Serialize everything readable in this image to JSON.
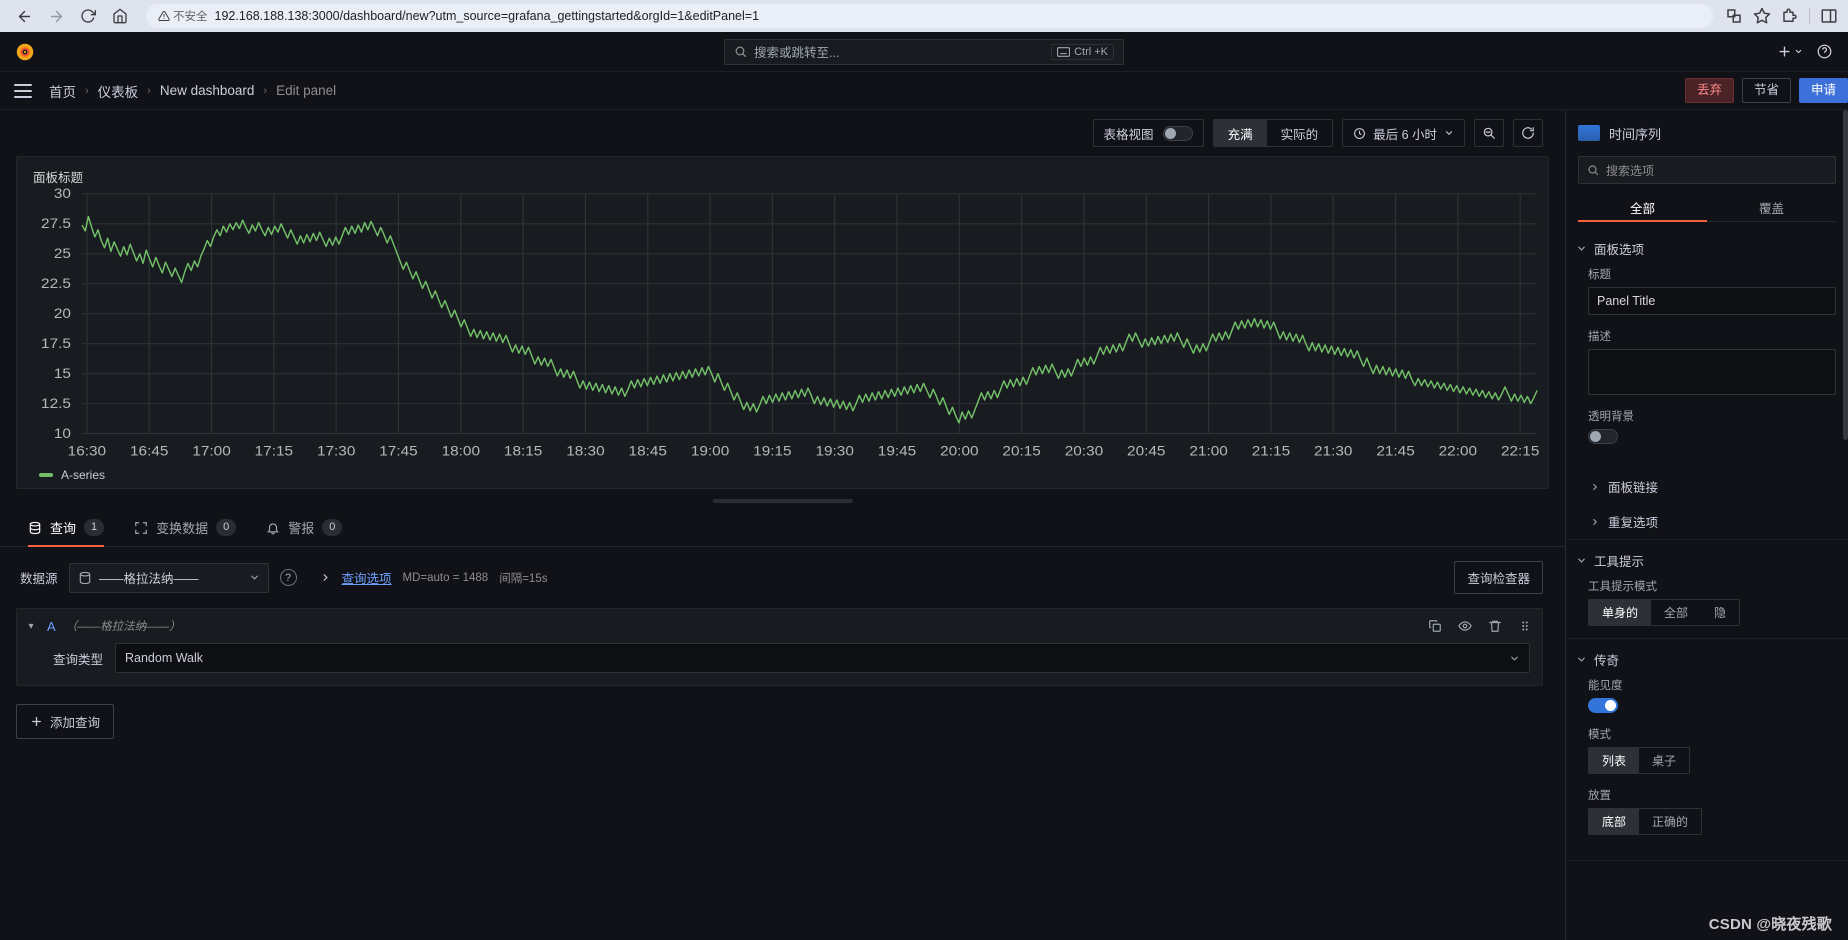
{
  "browser": {
    "back_icon": "back-arrow-icon",
    "forward_icon": "forward-arrow-icon",
    "reload_icon": "reload-icon",
    "home_icon": "home-icon",
    "security_label": "不安全",
    "url": "192.168.188.138:3000/dashboard/new?utm_source=grafana_gettingstarted&orgId=1&editPanel=1",
    "translate_icon": "translate-icon",
    "bookmark_icon": "star-icon",
    "extensions_icon": "puzzle-icon",
    "sidepanel_icon": "side-panel-icon"
  },
  "topnav": {
    "logo": "grafana-logo",
    "search_placeholder": "搜索或跳转至...",
    "search_icon": "search-icon",
    "shortcut_label": "Ctrl +K",
    "shortcut_icon": "keyboard-icon",
    "plus_label": "+",
    "help_icon": "help-circle-icon",
    "chevron_icon": "chevron-down-icon"
  },
  "breadcrumb": {
    "menu_icon": "hamburger-menu-icon",
    "items": [
      {
        "label": "首页",
        "dim": false
      },
      {
        "label": "仪表板",
        "dim": false
      },
      {
        "label": "New dashboard",
        "dim": false
      },
      {
        "label": "Edit panel",
        "dim": true
      }
    ],
    "separator": "›",
    "discard_label": "丢弃",
    "save_label": "节省",
    "apply_label": "申请"
  },
  "panel_toolbar": {
    "table_view_label": "表格视图",
    "table_view_on": false,
    "fill_label": "充满",
    "actual_label": "实际的",
    "fill_active": true,
    "time_range_label": "最后 6 小时",
    "clock_icon": "clock-icon",
    "time_chevron_icon": "chevron-down-icon",
    "zoom_out_icon": "zoom-out-icon",
    "refresh_icon": "refresh-icon"
  },
  "panel": {
    "title": "面板标题"
  },
  "chart_data": {
    "type": "line",
    "title": "面板标题",
    "xlabel": "",
    "ylabel": "",
    "ylim": [
      10,
      30
    ],
    "yticks": [
      30,
      27.5,
      25,
      22.5,
      20,
      17.5,
      15,
      12.5,
      10
    ],
    "xticks": [
      "16:30",
      "16:45",
      "17:00",
      "17:15",
      "17:30",
      "17:45",
      "18:00",
      "18:15",
      "18:30",
      "18:45",
      "19:00",
      "19:15",
      "19:30",
      "19:45",
      "20:00",
      "20:15",
      "20:30",
      "20:45",
      "21:00",
      "21:15",
      "21:30",
      "21:45",
      "22:00",
      "22:15"
    ],
    "grid": true,
    "legend_position": "bottom",
    "series": [
      {
        "name": "A-series",
        "color": "#73bf69",
        "values": [
          27.4,
          26.9,
          28.1,
          27.2,
          26.4,
          27.0,
          26.1,
          25.5,
          26.3,
          25.2,
          26.0,
          25.4,
          24.8,
          25.6,
          24.9,
          25.8,
          25.1,
          24.4,
          25.0,
          24.2,
          25.3,
          24.6,
          23.9,
          24.7,
          24.0,
          23.4,
          24.3,
          23.7,
          23.1,
          23.8,
          23.2,
          22.6,
          23.5,
          24.2,
          23.6,
          24.4,
          23.9,
          24.8,
          25.4,
          26.1,
          25.6,
          26.4,
          27.0,
          26.5,
          27.3,
          26.8,
          27.5,
          27.0,
          27.6,
          27.1,
          27.8,
          27.2,
          26.7,
          27.4,
          26.9,
          27.6,
          27.0,
          26.5,
          27.2,
          26.6,
          27.3,
          26.8,
          27.5,
          26.9,
          26.3,
          27.0,
          26.4,
          25.8,
          26.5,
          25.9,
          26.6,
          26.0,
          26.7,
          26.1,
          26.8,
          26.2,
          25.6,
          26.3,
          25.7,
          26.4,
          25.8,
          26.5,
          27.2,
          26.6,
          27.3,
          26.7,
          27.4,
          26.8,
          27.6,
          27.0,
          27.7,
          27.1,
          26.5,
          27.2,
          26.6,
          25.9,
          26.5,
          25.8,
          25.1,
          24.4,
          23.7,
          24.3,
          23.6,
          22.9,
          23.5,
          22.8,
          22.1,
          22.7,
          22.0,
          21.3,
          21.9,
          21.2,
          20.5,
          21.1,
          20.4,
          19.7,
          20.3,
          19.6,
          18.9,
          19.5,
          18.8,
          18.1,
          18.7,
          18.0,
          18.6,
          17.9,
          18.5,
          17.8,
          18.4,
          17.7,
          18.3,
          17.6,
          18.2,
          17.5,
          16.8,
          17.4,
          16.7,
          17.3,
          16.6,
          17.2,
          16.5,
          15.8,
          16.4,
          15.7,
          16.3,
          15.6,
          16.2,
          15.5,
          14.8,
          15.4,
          14.7,
          15.3,
          14.6,
          15.2,
          14.5,
          13.8,
          14.4,
          13.7,
          14.3,
          13.6,
          14.2,
          13.5,
          14.1,
          13.4,
          14.0,
          13.3,
          13.9,
          13.2,
          13.8,
          13.1,
          13.7,
          14.4,
          13.8,
          14.5,
          13.9,
          14.6,
          14.0,
          14.7,
          14.1,
          14.8,
          14.2,
          14.9,
          14.3,
          15.0,
          14.4,
          15.1,
          14.5,
          15.2,
          14.6,
          15.3,
          14.7,
          15.4,
          14.8,
          15.5,
          14.9,
          15.6,
          15.0,
          14.3,
          15.0,
          14.3,
          13.6,
          14.2,
          13.5,
          12.8,
          13.4,
          12.7,
          12.0,
          12.6,
          11.9,
          12.5,
          11.8,
          12.4,
          13.1,
          12.5,
          13.2,
          12.6,
          13.3,
          12.7,
          13.4,
          12.8,
          13.5,
          12.9,
          13.6,
          13.0,
          13.7,
          13.1,
          13.8,
          13.2,
          12.5,
          13.1,
          12.4,
          13.0,
          12.3,
          12.9,
          12.2,
          12.8,
          12.1,
          12.7,
          12.0,
          12.6,
          11.9,
          12.5,
          13.2,
          12.6,
          13.3,
          12.7,
          13.4,
          12.8,
          13.5,
          12.9,
          13.6,
          13.0,
          13.7,
          13.1,
          13.8,
          13.2,
          13.9,
          13.3,
          14.0,
          13.4,
          14.1,
          13.5,
          14.2,
          13.6,
          13.0,
          13.7,
          13.1,
          12.4,
          13.0,
          12.3,
          11.6,
          12.2,
          11.5,
          10.9,
          11.8,
          11.2,
          11.9,
          11.3,
          12.0,
          12.7,
          13.4,
          12.8,
          13.5,
          12.9,
          13.6,
          13.0,
          13.7,
          14.4,
          13.8,
          14.5,
          13.9,
          14.6,
          14.0,
          14.7,
          14.1,
          14.8,
          15.5,
          14.9,
          15.6,
          15.0,
          15.7,
          15.1,
          15.8,
          15.2,
          14.6,
          15.3,
          14.7,
          15.4,
          14.8,
          15.5,
          16.2,
          15.6,
          16.3,
          15.7,
          16.4,
          15.8,
          16.5,
          17.2,
          16.6,
          17.3,
          16.7,
          17.4,
          16.8,
          17.5,
          16.9,
          17.6,
          18.3,
          17.7,
          18.4,
          17.8,
          17.2,
          17.9,
          17.3,
          18.0,
          17.4,
          18.1,
          17.5,
          18.2,
          17.6,
          18.3,
          17.7,
          18.4,
          17.8,
          17.2,
          17.9,
          17.3,
          16.7,
          17.4,
          16.8,
          17.5,
          16.9,
          17.6,
          18.3,
          17.7,
          18.4,
          17.8,
          18.5,
          17.9,
          18.6,
          19.3,
          18.7,
          19.4,
          18.8,
          19.5,
          18.9,
          19.6,
          18.9,
          19.5,
          18.8,
          19.4,
          18.7,
          19.3,
          18.6,
          17.9,
          18.5,
          17.8,
          18.4,
          17.7,
          18.3,
          17.6,
          18.2,
          17.5,
          16.9,
          17.6,
          16.9,
          17.5,
          16.8,
          17.4,
          16.7,
          17.3,
          16.6,
          17.2,
          16.5,
          17.1,
          16.4,
          17.0,
          16.3,
          16.9,
          16.2,
          15.6,
          16.3,
          15.6,
          15.0,
          15.7,
          15.0,
          15.6,
          14.9,
          15.5,
          14.8,
          15.4,
          14.7,
          15.3,
          14.6,
          15.2,
          14.5,
          14.0,
          14.6,
          14.0,
          14.5,
          13.9,
          14.4,
          13.8,
          14.3,
          13.7,
          14.2,
          13.6,
          14.1,
          13.5,
          14.0,
          13.4,
          13.9,
          13.3,
          13.8,
          13.2,
          13.7,
          13.1,
          13.6,
          13.0,
          13.5,
          12.9,
          13.4,
          12.8,
          13.3,
          13.9,
          13.3,
          12.7,
          13.3,
          12.7,
          13.2,
          12.6,
          13.1,
          12.5,
          13.0,
          13.6
        ]
      }
    ]
  },
  "query_tabs": {
    "items": [
      {
        "label": "查询",
        "count": "1",
        "icon": "database-icon",
        "active": true
      },
      {
        "label": "变换数据",
        "count": "0",
        "icon": "transform-icon",
        "active": false
      },
      {
        "label": "警报",
        "count": "0",
        "icon": "bell-icon",
        "active": false
      }
    ]
  },
  "datasource_row": {
    "label": "数据源",
    "selected": "——格拉法纳——",
    "db_icon": "database-icon",
    "chevron_icon": "chevron-down-icon",
    "help_icon": "question-mark-icon",
    "expand_icon": "chevron-right-icon",
    "query_options_label": "查询选项",
    "md_label": "MD=auto = 1488",
    "interval_label": "间隔=15s",
    "inspector_label": "查询检查器"
  },
  "query_editor": {
    "ref_id": "A",
    "datasource": "（——格拉法纳——）",
    "collapse_icon": "chevron-down-icon",
    "duplicate_icon": "copy-icon",
    "hide_icon": "eye-icon",
    "delete_icon": "trash-icon",
    "drag_icon": "drag-handle-icon",
    "query_type_label": "查询类型",
    "query_type_value": "Random Walk",
    "query_type_chevron": "chevron-down-icon"
  },
  "add_query": {
    "label": "添加查询",
    "icon": "plus-icon"
  },
  "options_pane": {
    "viz_name": "时间序列",
    "viz_icon": "timeseries-icon",
    "search_placeholder": "搜索选项",
    "search_icon": "search-icon",
    "tabs": [
      {
        "label": "全部",
        "active": true
      },
      {
        "label": "覆盖",
        "active": false
      }
    ],
    "groups": [
      {
        "title": "面板选项",
        "chevron": "chevron-down-icon",
        "fields": {
          "title_label": "标题",
          "title_value": "Panel Title",
          "description_label": "描述",
          "description_value": "",
          "transparent_label": "透明背景",
          "transparent_on": false
        },
        "sub_items": [
          {
            "label": "面板链接",
            "chevron": "chevron-right-icon"
          },
          {
            "label": "重复选项",
            "chevron": "chevron-right-icon"
          }
        ]
      },
      {
        "title": "工具提示",
        "chevron": "chevron-down-icon",
        "tooltip_mode_label": "工具提示模式",
        "tooltip_modes": [
          {
            "label": "单身的",
            "active": true
          },
          {
            "label": "全部",
            "active": false
          },
          {
            "label": "隐",
            "active": false
          }
        ]
      },
      {
        "title": "传奇",
        "chevron": "chevron-down-icon",
        "visibility_label": "能见度",
        "visibility_on": true,
        "mode_label": "模式",
        "modes": [
          {
            "label": "列表",
            "active": true
          },
          {
            "label": "桌子",
            "active": false
          }
        ],
        "placement_label": "放置",
        "placements": [
          {
            "label": "底部",
            "active": true
          },
          {
            "label": "正确的",
            "active": false
          }
        ]
      }
    ]
  },
  "watermark": "CSDN @晓夜残歌"
}
